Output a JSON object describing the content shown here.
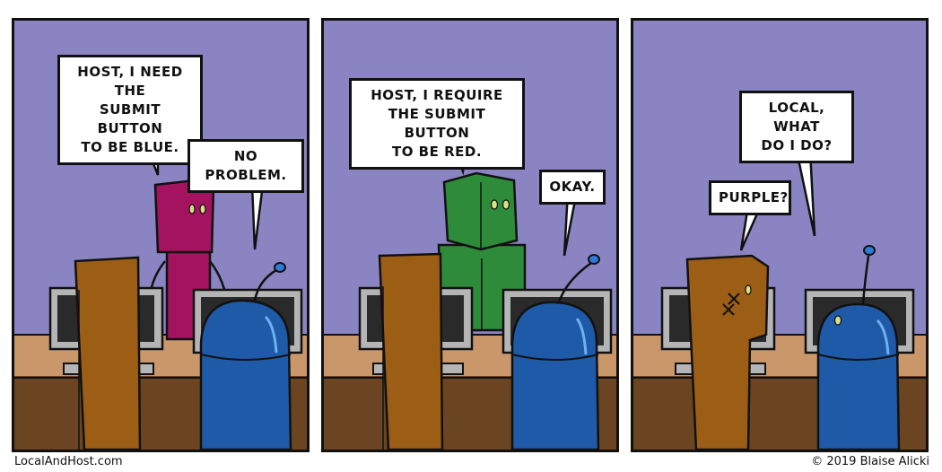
{
  "panels": [
    {
      "bubbles": [
        {
          "speaker": "pink-character",
          "text": "HOST, I NEED THE\nSUBMIT BUTTON\nTO BE BLUE."
        },
        {
          "speaker": "host-robot",
          "text": "NO PROBLEM."
        }
      ]
    },
    {
      "bubbles": [
        {
          "speaker": "green-character",
          "text": "HOST, I REQUIRE\nTHE SUBMIT BUTTON\nTO BE RED."
        },
        {
          "speaker": "host-robot",
          "text": "OKAY."
        }
      ]
    },
    {
      "bubbles": [
        {
          "speaker": "host-robot",
          "text": "LOCAL, WHAT\nDO I DO?"
        },
        {
          "speaker": "local-character",
          "text": "PURPLE?"
        }
      ]
    }
  ],
  "footer": {
    "site": "LocalAndHost.com",
    "copyright": "© 2019 Blaise Alicki"
  },
  "colors": {
    "wall": "#8a84c2",
    "desk_top": "#c9976a",
    "desk_front": "#6b4422",
    "local_brown": "#9c5e14",
    "host_blue": "#1e5aa8",
    "pink": "#a3135f",
    "green": "#2e8b3a",
    "monitor_frame": "#b5b5b5",
    "monitor_screen": "#2a2a2a"
  }
}
